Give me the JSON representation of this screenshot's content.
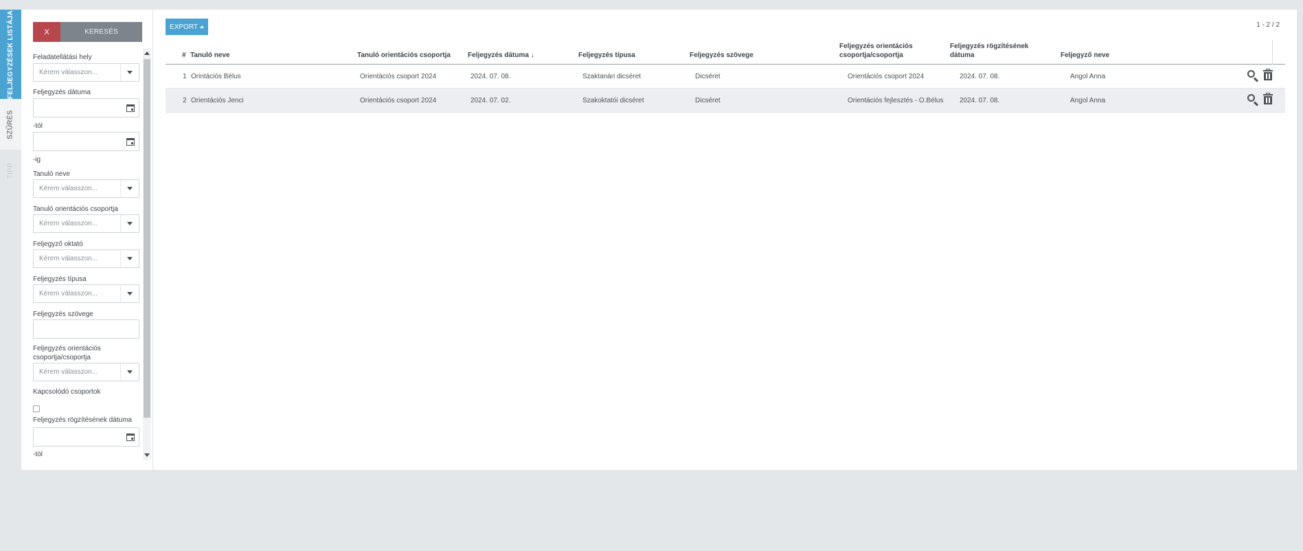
{
  "sidebar_tabs": [
    "FELJEGYZÉSEK LISTÁJA",
    "SZŰRÉS",
    "TIPP"
  ],
  "filter": {
    "clear_label": "X",
    "search_label": "KERESÉS",
    "select_placeholder": "Kérem válasszon...",
    "labels": {
      "feladatellatasi_hely": "Feladatellátási hely",
      "feljegyzes_datuma": "Feljegyzés dátuma",
      "tol": "-tól",
      "ig": "-ig",
      "tanulo_neve": "Tanuló neve",
      "tanulo_orientacios_csoportja": "Tanuló orientációs csoportja",
      "feljegyzo_oktato": "Feljegyző oktató",
      "feljegyzes_tipusa": "Feljegyzés típusa",
      "feljegyzes_szovege": "Feljegyzés szövege",
      "feljegyzes_orientacios": "Feljegyzés orientációs",
      "csoportja": "csoportja/csoportja",
      "kapcsolodo_csoportok": "Kapcsolódó csoportok",
      "rogzites_datuma": "Feljegyzés rögzítésének dátuma",
      "tol2": "-tól"
    }
  },
  "toolbar": {
    "export_label": "EXPORT",
    "pager": "1 - 2 / 2"
  },
  "table": {
    "columns": {
      "num": "#",
      "name": "Tanuló neve",
      "group": "Tanuló orientációs csoportja",
      "date": "Feljegyzés dátuma",
      "date_sort": "↓",
      "type": "Feljegyzés típusa",
      "text": "Feljegyzés szövege",
      "orient_l1": "Feljegyzés orientációs",
      "orient_l2": "csoportja/csoportja",
      "recdate_l1": "Feljegyzés rögzítésének",
      "recdate_l2": "dátuma",
      "author": "Feljegyző neve"
    },
    "rows": [
      {
        "num": "1",
        "name": "Orintációs Bélus",
        "group": "Orientációs csoport 2024",
        "date": "2024. 07. 08.",
        "type": "Szaktanári dicséret",
        "text": "Dicséret",
        "orient": "Orientációs csoport 2024",
        "recdate": "2024. 07. 08.",
        "author": "Angol Anna"
      },
      {
        "num": "2",
        "name": "Orientációs Jenci",
        "group": "Orientációs csoport 2024",
        "date": "2024. 07. 02.",
        "type": "Szakoktatói dicséret",
        "text": "Dicséret",
        "orient": "Orientációs fejlesztés - O.Bélus",
        "recdate": "2024. 07. 08.",
        "author": "Angol Anna"
      }
    ]
  },
  "colors": {
    "accent": "#4aa3d3",
    "danger": "#b8474d",
    "muted_button": "#7d848c",
    "background": "#e4e7ea"
  }
}
